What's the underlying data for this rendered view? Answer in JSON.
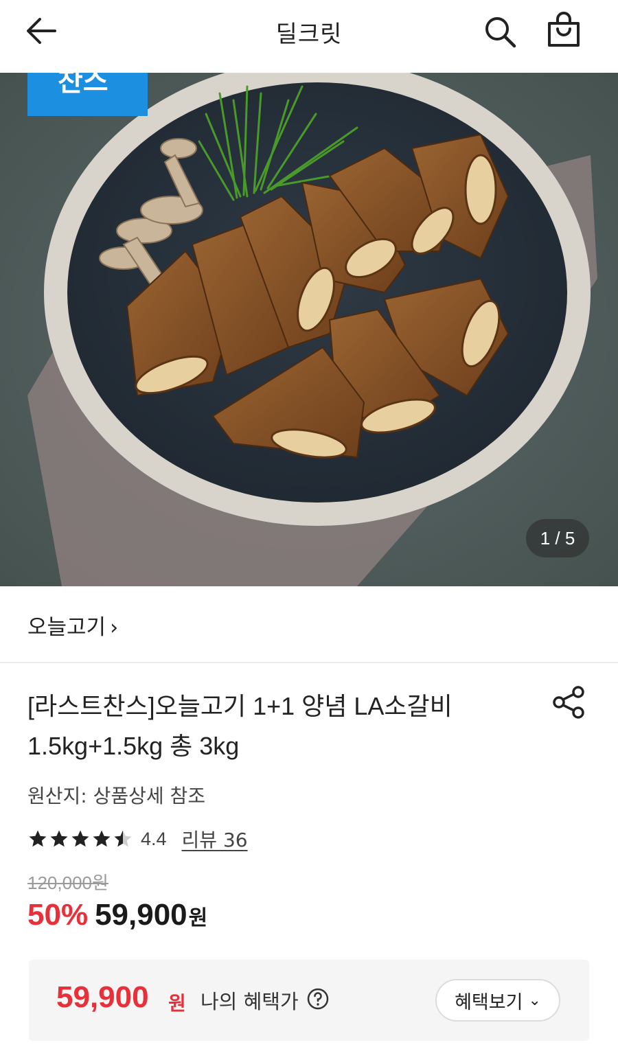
{
  "header": {
    "title": "딜크릿",
    "back_icon": "arrow-left-icon",
    "search_icon": "search-icon",
    "cart_icon": "shopping-bag-icon"
  },
  "gallery": {
    "badge_text": "찬스",
    "pager": "1 / 5",
    "accent_color": "#1d8fe0"
  },
  "store": {
    "name": "오늘고기",
    "chevron": "›"
  },
  "product": {
    "title_line1": "[라스트찬스]오늘고기 1+1 양념 LA소갈비",
    "title_line2": "1.5kg+1.5kg 총 3kg",
    "origin": "원산지: 상품상세 참조",
    "rating": 4.4,
    "rating_text": "4.4",
    "review_label": "리뷰 36",
    "original_price": "120,000원",
    "discount": "50%",
    "sale_price": "59,900",
    "currency": "원",
    "sale_color": "#e8303a"
  },
  "benefit": {
    "price": "59,900",
    "currency": "원",
    "label": "나의 혜택가",
    "button_label": "혜택보기",
    "button_chevron": "⌄"
  }
}
